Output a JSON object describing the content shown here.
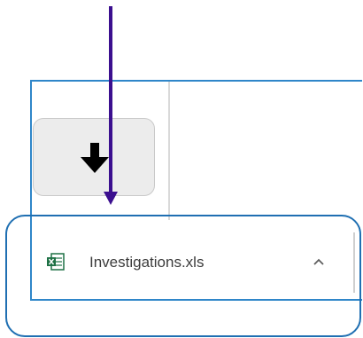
{
  "download_bar": {
    "download_button_icon": "down-arrow-icon",
    "item": {
      "file_name": "Investigations.xls",
      "file_icon": "excel-file-icon",
      "menu_icon": "chevron-up-icon"
    }
  },
  "annotation": {
    "arrow_color": "#3b0f8f",
    "highlight_color": "#1f6fb2"
  }
}
